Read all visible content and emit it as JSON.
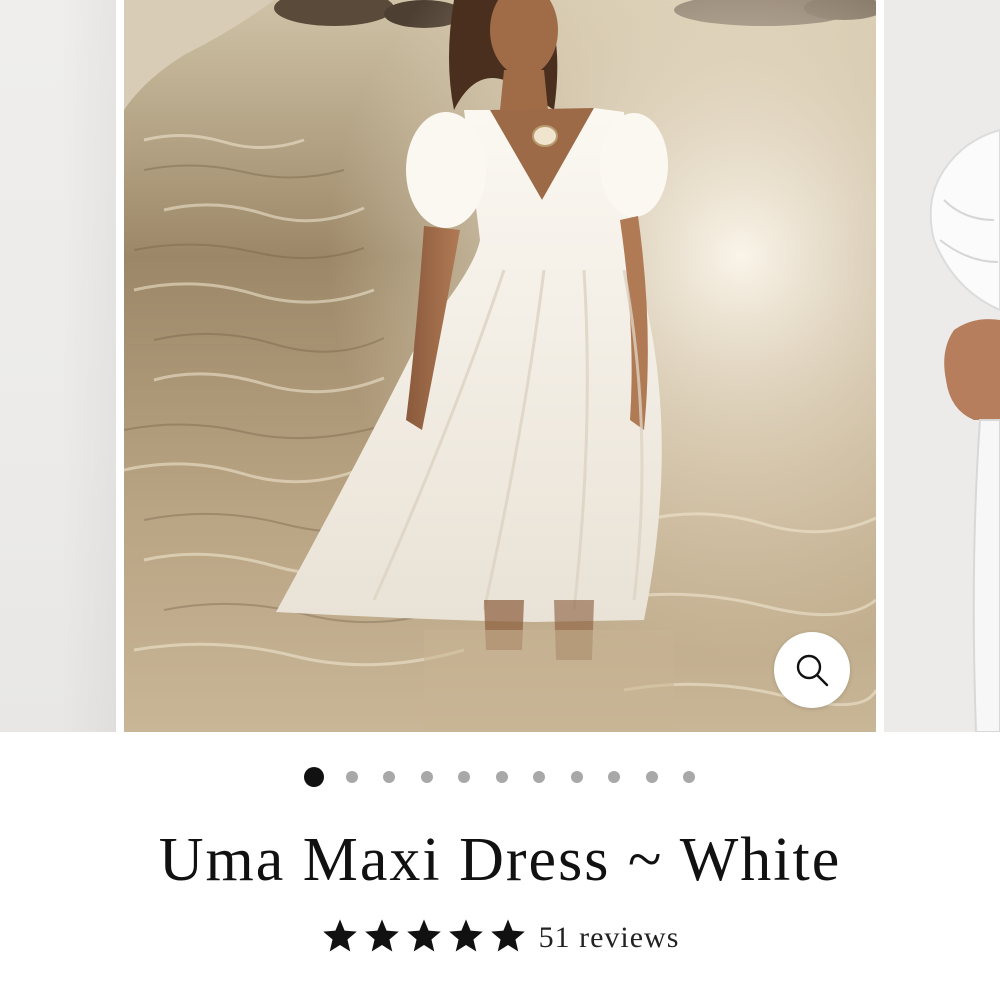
{
  "product": {
    "title": "Uma Maxi Dress ~ White",
    "rating": 5,
    "rating_max": 5,
    "reviews_label": "51 reviews"
  },
  "gallery": {
    "slide_count": 11,
    "active_index": 0,
    "main_image": "model-in-white-dress-wading-in-sea",
    "zoom_icon": "search-icon"
  },
  "colors": {
    "text": "#111111",
    "dot_active": "#111111",
    "dot_inactive": "#a8a8a8",
    "star": "#111111"
  }
}
